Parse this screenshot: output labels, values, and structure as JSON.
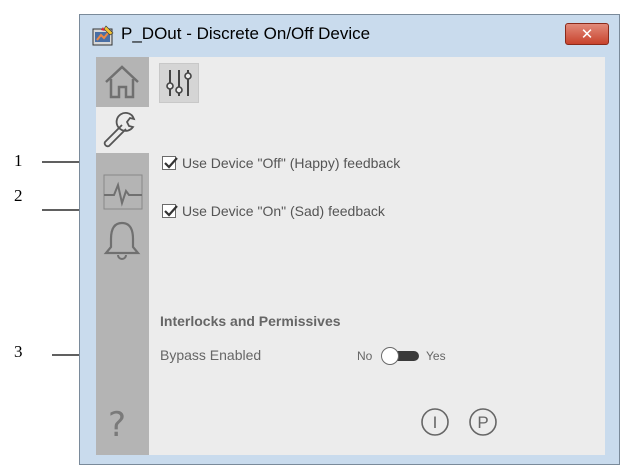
{
  "window": {
    "title": "P_DOut - Discrete On/Off Device",
    "close_icon": "close-icon"
  },
  "callouts": [
    "1",
    "2",
    "3"
  ],
  "sidebar": {
    "tabs": [
      {
        "name": "home-icon"
      },
      {
        "name": "wrench-icon",
        "active": true
      },
      {
        "name": "trend-icon"
      },
      {
        "name": "bell-icon"
      }
    ],
    "help": "?"
  },
  "content": {
    "settings_icon": "sliders-icon",
    "checkboxes": [
      {
        "label": "Use Device \"Off\" (Happy) feedback",
        "checked": true
      },
      {
        "label": "Use Device \"On\" (Sad) feedback",
        "checked": true
      }
    ],
    "section_title": "Interlocks and Permissives",
    "bypass": {
      "label": "Bypass Enabled",
      "off_label": "No",
      "on_label": "Yes",
      "value": "No"
    },
    "bottom_buttons": [
      {
        "name": "interlock-button",
        "glyph": "I"
      },
      {
        "name": "permissive-button",
        "glyph": "P"
      }
    ]
  }
}
